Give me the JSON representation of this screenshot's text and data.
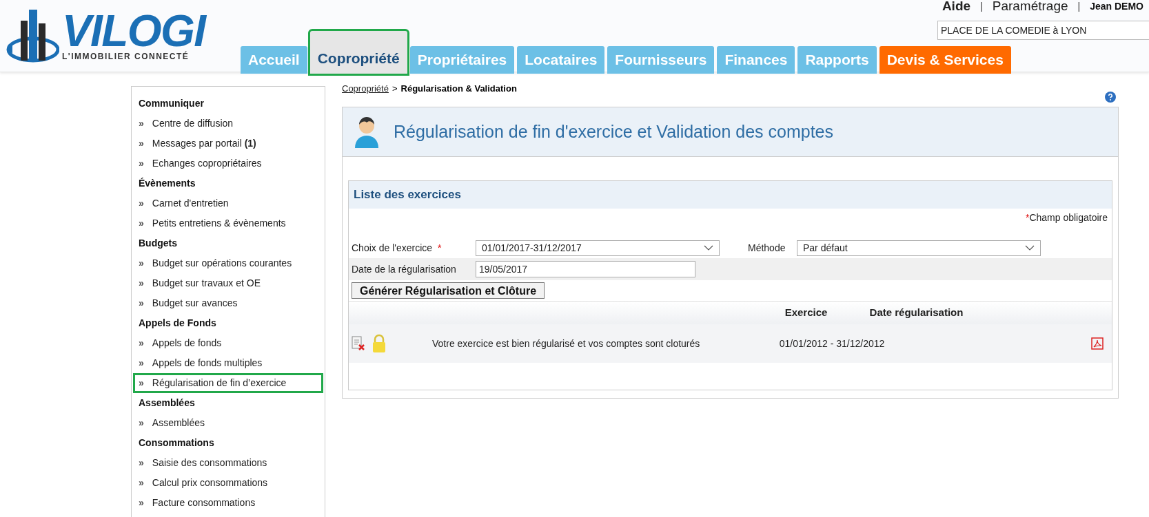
{
  "logo": {
    "name": "VILOGI",
    "tagline": "L'IMMOBILIER CONNECTÉ"
  },
  "top_links": [
    {
      "label": "Aide",
      "kind": "strong"
    },
    {
      "label": "Paramétrage",
      "kind": "plain"
    },
    {
      "label": "Jean DEMO",
      "kind": "user"
    }
  ],
  "separators": [
    "|",
    "|"
  ],
  "building_field": {
    "value": "PLACE DE LA COMEDIE à LYON"
  },
  "tabs": [
    {
      "label": "Accueil",
      "kind": "standard",
      "selected": false,
      "highlighted": false
    },
    {
      "label": "Copropriété",
      "kind": "standard",
      "selected": true,
      "highlighted": true
    },
    {
      "label": "Propriétaires",
      "kind": "standard",
      "selected": false,
      "highlighted": false
    },
    {
      "label": "Locataires",
      "kind": "standard",
      "selected": false,
      "highlighted": false
    },
    {
      "label": "Fournisseurs",
      "kind": "standard",
      "selected": false,
      "highlighted": false
    },
    {
      "label": "Finances",
      "kind": "standard",
      "selected": false,
      "highlighted": false
    },
    {
      "label": "Rapports",
      "kind": "standard",
      "selected": false,
      "highlighted": false
    },
    {
      "label": "Devis & Services",
      "kind": "service",
      "selected": false,
      "highlighted": false
    }
  ],
  "sidebar": {
    "sections": [
      {
        "title": "Communiquer",
        "items": [
          {
            "label": "Centre de diffusion",
            "highlighted": false
          },
          {
            "label": "Messages par portail **(1)**",
            "highlighted": false
          },
          {
            "label": "Echanges copropriétaires",
            "highlighted": false
          }
        ]
      },
      {
        "title": "Évènements",
        "items": [
          {
            "label": "Carnet d'entretien",
            "highlighted": false
          },
          {
            "label": "Petits entretiens & évènements",
            "highlighted": false
          }
        ]
      },
      {
        "title": "Budgets",
        "items": [
          {
            "label": "Budget sur opérations courantes",
            "highlighted": false
          },
          {
            "label": "Budget sur travaux et OE",
            "highlighted": false
          },
          {
            "label": "Budget sur avances",
            "highlighted": false
          }
        ]
      },
      {
        "title": "Appels de Fonds",
        "items": [
          {
            "label": "Appels de fonds",
            "highlighted": false
          },
          {
            "label": "Appels de fonds multiples",
            "highlighted": false
          },
          {
            "label": "Régularisation de fin d’exercice",
            "highlighted": true
          }
        ]
      },
      {
        "title": "Assemblées",
        "items": [
          {
            "label": "Assemblées",
            "highlighted": false
          }
        ]
      },
      {
        "title": "Consommations",
        "items": [
          {
            "label": "Saisie des consommations",
            "highlighted": false
          },
          {
            "label": "Calcul prix consommations",
            "highlighted": false
          },
          {
            "label": "Facture consommations",
            "highlighted": false
          }
        ]
      }
    ]
  },
  "bullet": "»",
  "breadcrumb": {
    "link": "Copropriété",
    "separator": ">",
    "current": "Régularisation & Validation"
  },
  "page_title": "Régularisation de fin d'exercice et Validation des comptes",
  "panel": {
    "title": "Liste des exercices",
    "required_mark": "*",
    "required_note": "Champ obligatoire",
    "fields": [
      {
        "label": "Choix de l'exercice",
        "required": true,
        "value": "01/01/2017-31/12/2017"
      },
      {
        "label": "Méthode",
        "required": false,
        "value": "Par défaut"
      },
      {
        "label": "Date de la régularisation",
        "required": false,
        "value": "19/05/2017"
      }
    ],
    "button": "Générer Régularisation et Clôture"
  },
  "table": {
    "columns": [
      "Exercice",
      "Date régularisation"
    ],
    "rows": [
      {
        "message": "Votre exercice est bien régularisé et vos comptes sont cloturés",
        "exercice": "01/01/2012 - 31/12/2012",
        "locked": true
      }
    ]
  }
}
